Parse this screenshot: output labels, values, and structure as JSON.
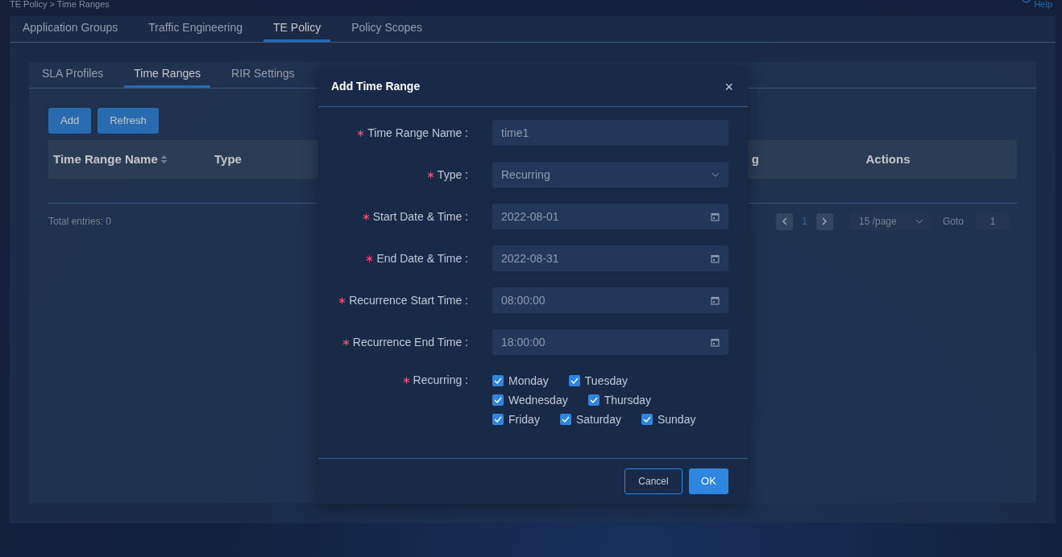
{
  "breadcrumb": "TE Policy > Time Ranges",
  "help": "Help",
  "tabs": [
    {
      "label": "Application Groups",
      "selected": false
    },
    {
      "label": "Traffic Engineering",
      "selected": false
    },
    {
      "label": "TE Policy",
      "selected": true
    },
    {
      "label": "Policy Scopes",
      "selected": false
    }
  ],
  "subtabs": [
    {
      "label": "SLA Profiles",
      "selected": false
    },
    {
      "label": "Time Ranges",
      "selected": true
    },
    {
      "label": "RIR Settings",
      "selected": false
    }
  ],
  "toolbar": [
    "Add",
    "Refresh"
  ],
  "table": {
    "columns": [
      {
        "label": "Time Range Name",
        "sortable": true
      },
      {
        "label": "Type",
        "sortable": false
      },
      {
        "label": "g",
        "sortable": false
      },
      {
        "label": "Actions",
        "sortable": false
      }
    ]
  },
  "footer": {
    "total": "Total entries: 0",
    "page": "1",
    "page_size": "15 /page",
    "goto_label": "Goto",
    "goto_value": "1"
  },
  "dialog": {
    "title": "Add Time Range",
    "close": "×",
    "fields": [
      {
        "label": "Time Range Name :",
        "kind": "text",
        "value": "time1",
        "required": true
      },
      {
        "label": "Type :",
        "kind": "select",
        "value": "Recurring",
        "required": true
      },
      {
        "label": "Start Date & Time :",
        "kind": "date",
        "value": "2022-08-01",
        "required": true
      },
      {
        "label": "End Date & Time :",
        "kind": "date",
        "value": "2022-08-31",
        "required": true
      },
      {
        "label": "Recurrence Start Time :",
        "kind": "date",
        "value": "08:00:00",
        "required": true
      },
      {
        "label": "Recurrence End Time :",
        "kind": "date",
        "value": "18:00:00",
        "required": true
      }
    ],
    "recurring": {
      "label": "Recurring :",
      "required": true,
      "rows": [
        [
          {
            "label": "Monday",
            "checked": true
          },
          {
            "label": "Tuesday",
            "checked": true
          }
        ],
        [
          {
            "label": "Wednesday",
            "checked": true
          },
          {
            "label": "Thursday",
            "checked": true
          }
        ],
        [
          {
            "label": "Friday",
            "checked": true
          },
          {
            "label": "Saturday",
            "checked": true
          },
          {
            "label": "Sunday",
            "checked": true
          }
        ]
      ]
    },
    "buttons": [
      {
        "label": "Cancel",
        "kind": "secondary"
      },
      {
        "label": "OK",
        "kind": "primary"
      }
    ]
  }
}
